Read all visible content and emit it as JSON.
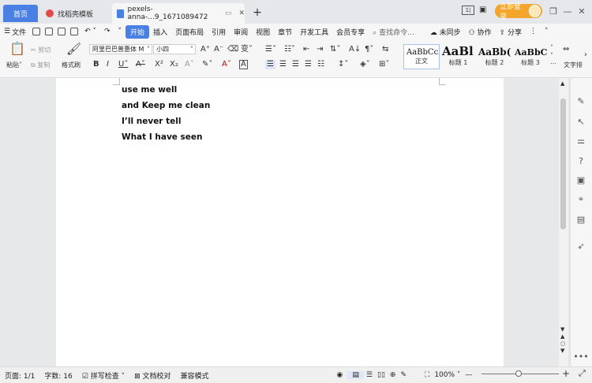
{
  "tabs": {
    "home": "首页",
    "template": "找稻壳模板",
    "document": "pexels-anna-...9_1671089472",
    "new_tab": "+"
  },
  "titlebar": {
    "layout_badge": "1|",
    "login": "立即登录"
  },
  "menu": {
    "file": "文件",
    "items": [
      "开始",
      "插入",
      "页面布局",
      "引用",
      "审阅",
      "视图",
      "章节",
      "开发工具",
      "会员专享"
    ],
    "search": "查找命令...",
    "sync": "未同步",
    "collab": "协作",
    "share": "分享"
  },
  "ribbon": {
    "paste": "粘贴",
    "cut": "剪切",
    "copy": "复制",
    "format_painter": "格式刷",
    "font_name": "阿里巴巴普惠体 M",
    "font_size": "小四",
    "text_layout": "文字排",
    "styles": [
      {
        "sample": "AaBbCcI",
        "name": "正文"
      },
      {
        "sample": "AaBl",
        "name": "标题 1"
      },
      {
        "sample": "AaBb(",
        "name": "标题 2"
      },
      {
        "sample": "AaBbC",
        "name": "标题 3"
      }
    ]
  },
  "document": {
    "lines": [
      "use me well",
      "and Keep  me clean",
      "I’ll never tell",
      "What I have seen"
    ]
  },
  "status": {
    "page": "页面: 1/1",
    "words": "字数: 16",
    "spell": "拼写检查",
    "proofread": "文档校对",
    "compat": "兼容模式",
    "zoom": "100%"
  }
}
